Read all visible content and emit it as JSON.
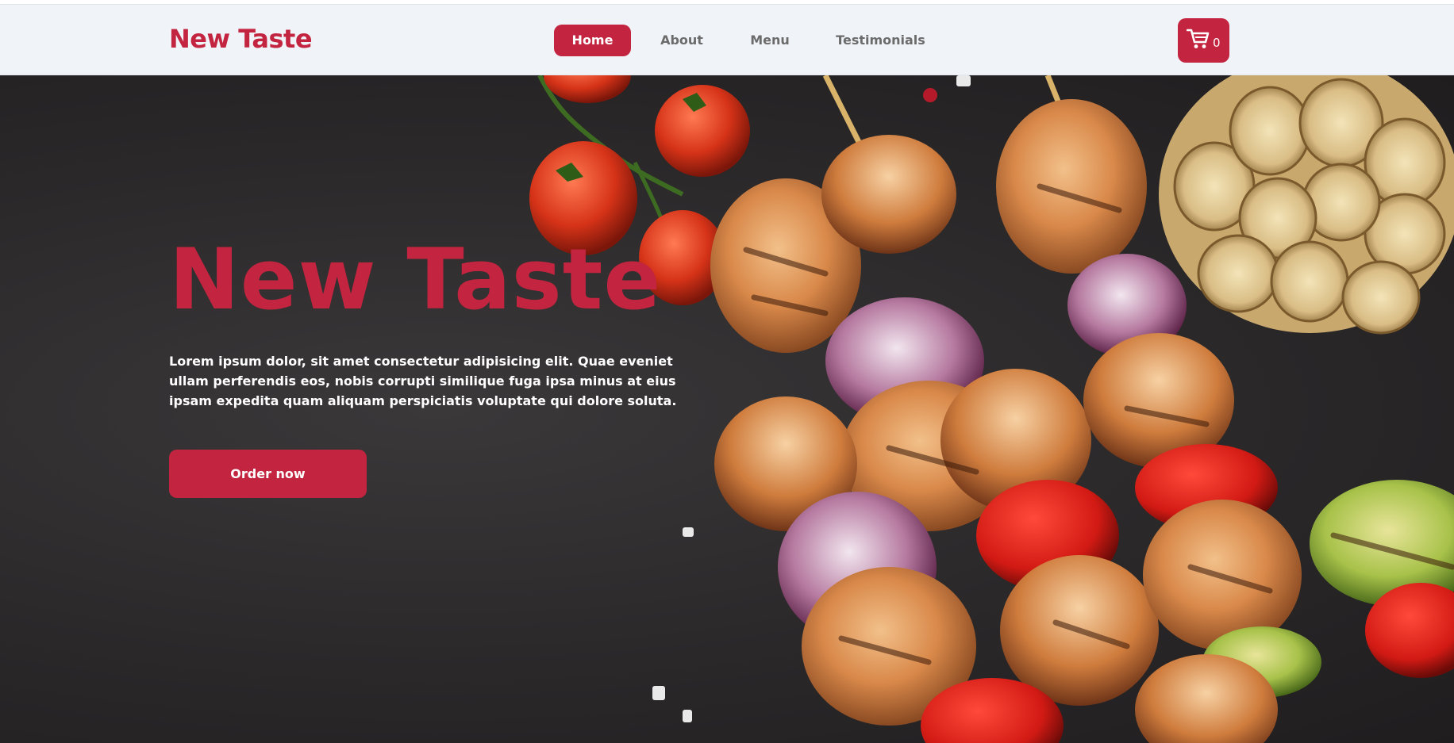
{
  "navbar": {
    "brand": "New Taste",
    "links": [
      {
        "label": "Home",
        "active": true
      },
      {
        "label": "About"
      },
      {
        "label": "Menu"
      },
      {
        "label": "Testimonials"
      }
    ],
    "cart": {
      "icon": "cart-icon",
      "count": "0"
    }
  },
  "hero": {
    "title": "New Taste",
    "text": "Lorem ipsum dolor, sit amet consectetur adipisicing elit. Quae eveniet ullam perferendis eos, nobis corrupti similique fuga ipsa minus at eius ipsam expedita quam aliquam perspiciatis voluptate qui dolore soluta.",
    "cta_label": "Order now",
    "image": "grilled-kebab-skewers-photo"
  },
  "colors": {
    "accent": "#c3243f",
    "navbar_bg": "#f0f3f8",
    "hero_bg": "#2a2829"
  }
}
